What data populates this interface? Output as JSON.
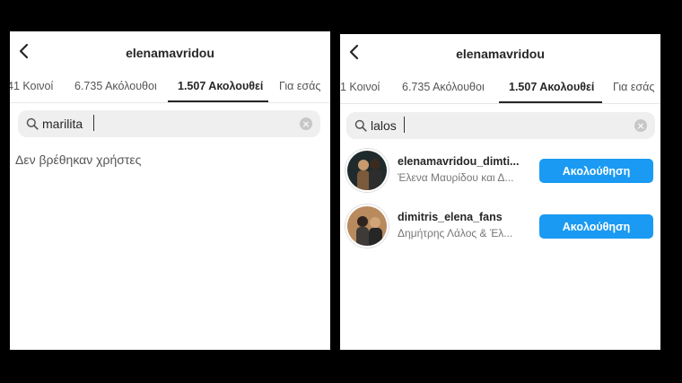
{
  "left": {
    "title": "elenamavridou",
    "tabs": [
      {
        "label": "41 Κοινοί"
      },
      {
        "label": "6.735 Ακόλουθοι"
      },
      {
        "label": "1.507 Ακολουθεί"
      },
      {
        "label": "Για εσάς"
      }
    ],
    "search": {
      "value": "marilita",
      "icon": "search-icon"
    },
    "empty_message": "Δεν βρέθηκαν χρήστες"
  },
  "right": {
    "title": "elenamavridou",
    "tabs": [
      {
        "label": "1 Κοινοί"
      },
      {
        "label": "6.735 Ακόλουθοι"
      },
      {
        "label": "1.507 Ακολουθεί"
      },
      {
        "label": "Για εσάς"
      }
    ],
    "search": {
      "value": "lalos",
      "icon": "search-icon"
    },
    "results": [
      {
        "username": "elenamavridou_dimti...",
        "fullname": "Έλενα Μαυρίδου και Δ...",
        "button": "Ακολούθηση"
      },
      {
        "username": "dimitris_elena_fans",
        "fullname": "Δημήτρης Λάλος & Έλ...",
        "button": "Ακολούθηση"
      }
    ]
  },
  "colors": {
    "accent": "#1a9af2",
    "background": "#000000"
  }
}
